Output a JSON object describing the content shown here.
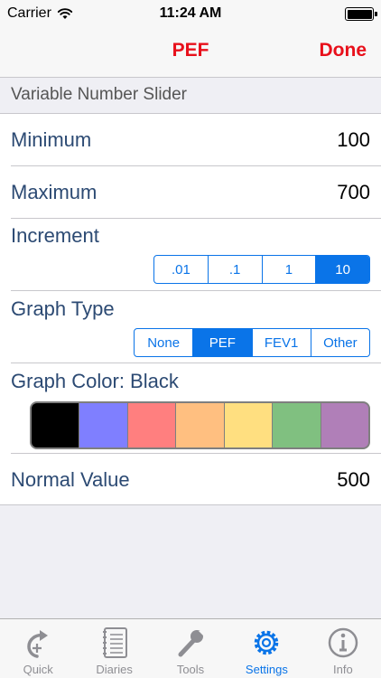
{
  "status_bar": {
    "carrier": "Carrier",
    "time": "11:24 AM"
  },
  "nav": {
    "title": "PEF",
    "done_label": "Done",
    "accent_color": "#e8101b"
  },
  "section": {
    "title": "Variable Number Slider"
  },
  "settings": {
    "minimum": {
      "label": "Minimum",
      "value": "100"
    },
    "maximum": {
      "label": "Maximum",
      "value": "700"
    },
    "increment": {
      "label": "Increment",
      "options": [
        ".01",
        ".1",
        "1",
        "10"
      ],
      "selected": "10"
    },
    "graph_type": {
      "label": "Graph Type",
      "options": [
        "None",
        "PEF",
        "FEV1",
        "Other"
      ],
      "selected": "PEF"
    },
    "graph_color": {
      "label": "Graph Color: Black",
      "swatches": [
        "#000000",
        "#7f7fff",
        "#ff7f7f",
        "#ffbf80",
        "#ffdf80",
        "#80c080",
        "#b07fb8"
      ]
    },
    "normal_value": {
      "label": "Normal Value",
      "value": "500"
    }
  },
  "tabbar": {
    "active_color": "#0a74e8",
    "tabs": [
      {
        "label": "Quick",
        "icon": "quick-add-icon"
      },
      {
        "label": "Diaries",
        "icon": "notebook-icon"
      },
      {
        "label": "Tools",
        "icon": "wrench-icon"
      },
      {
        "label": "Settings",
        "icon": "gear-icon",
        "active": true
      },
      {
        "label": "Info",
        "icon": "info-icon"
      }
    ]
  }
}
